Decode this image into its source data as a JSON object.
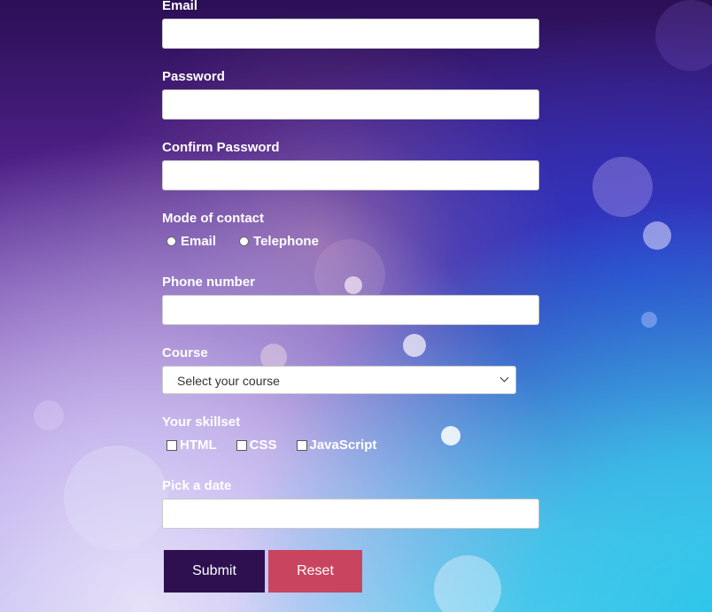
{
  "form": {
    "email_label": "Email",
    "password_label": "Password",
    "confirm_password_label": "Confirm Password",
    "mode_of_contact": {
      "label": "Mode of contact",
      "options": [
        "Email",
        "Telephone"
      ]
    },
    "phone_label": "Phone number",
    "course": {
      "label": "Course",
      "selected": "Select your course"
    },
    "skillset": {
      "label": "Your skillset",
      "options": [
        "HTML",
        "CSS",
        "JavaScript"
      ]
    },
    "date_label": "Pick a date",
    "submit_label": "Submit",
    "reset_label": "Reset"
  },
  "colors": {
    "submit_bg": "#2e1050",
    "reset_bg": "#c9455f",
    "label_text": "#ffffff"
  }
}
